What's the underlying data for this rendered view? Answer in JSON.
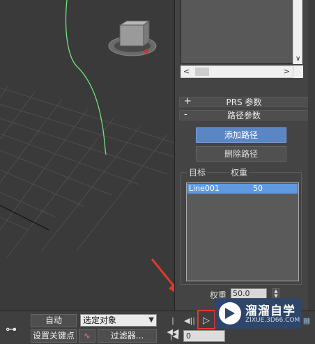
{
  "command_panel": {
    "prs_rollout": {
      "sign": "+",
      "title": "PRS 参数"
    },
    "path_rollout": {
      "sign": "-",
      "title": "路径参数"
    },
    "add_path_label": "添加路径",
    "delete_path_label": "删除路径",
    "targets_header": "目标",
    "weight_header": "权重",
    "targets": [
      {
        "name": "Line001",
        "weight": "50"
      }
    ],
    "weight_label": "权重",
    "weight_value": "50.0"
  },
  "scrollbar": {
    "down_arrow": "∨",
    "left_arrow": "<",
    "right_arrow": ">"
  },
  "bottom_bar": {
    "auto_key_label": "自动",
    "set_key_label": "设置关键点",
    "selection_filter_value": "选定对象",
    "filters_label": "过滤器...",
    "frame_value": "0",
    "playback": {
      "go_start": "|◀◀",
      "prev_frame": "◀||",
      "play": "▷"
    }
  },
  "watermark": {
    "title": "溜溜自学",
    "subtitle": "ZIXUE.3D66.COM"
  },
  "colors": {
    "accent_button": "#5a86c6",
    "selection": "#5f9ae0",
    "path_curve": "#6fe37a",
    "highlight": "#e23a2a"
  }
}
